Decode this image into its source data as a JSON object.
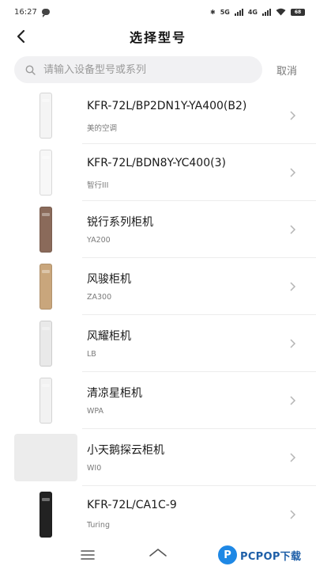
{
  "status_bar": {
    "time": "16:27",
    "network_1": "5G",
    "network_2": "4G",
    "battery": "68"
  },
  "header": {
    "title": "选择型号"
  },
  "search": {
    "placeholder": "请输入设备型号或系列",
    "cancel_label": "取消"
  },
  "models": [
    {
      "name": "KFR-72L/BP2DN1Y-YA400(B2)",
      "subtitle": "美的空调",
      "color": "#f4f4f4"
    },
    {
      "name": "KFR-72L/BDN8Y-YC400(3)",
      "subtitle": "智行III",
      "color": "#f7f7f7"
    },
    {
      "name": "锐行系列柜机",
      "subtitle": "YA200",
      "color": "#8a6a5a"
    },
    {
      "name": "风骏柜机",
      "subtitle": "ZA300",
      "color": "#c9a67c"
    },
    {
      "name": "风耀柜机",
      "subtitle": "LB",
      "color": "#e9e9e9"
    },
    {
      "name": "清凉星柜机",
      "subtitle": "WPA",
      "color": "#f2f2f2"
    },
    {
      "name": "小天鹅探云柜机",
      "subtitle": "WI0",
      "color": ""
    },
    {
      "name": "KFR-72L/CA1C-9",
      "subtitle": "Turing",
      "color": "#222222"
    }
  ],
  "watermark": {
    "logo_letter": "P",
    "text": "PCPOP下载"
  }
}
